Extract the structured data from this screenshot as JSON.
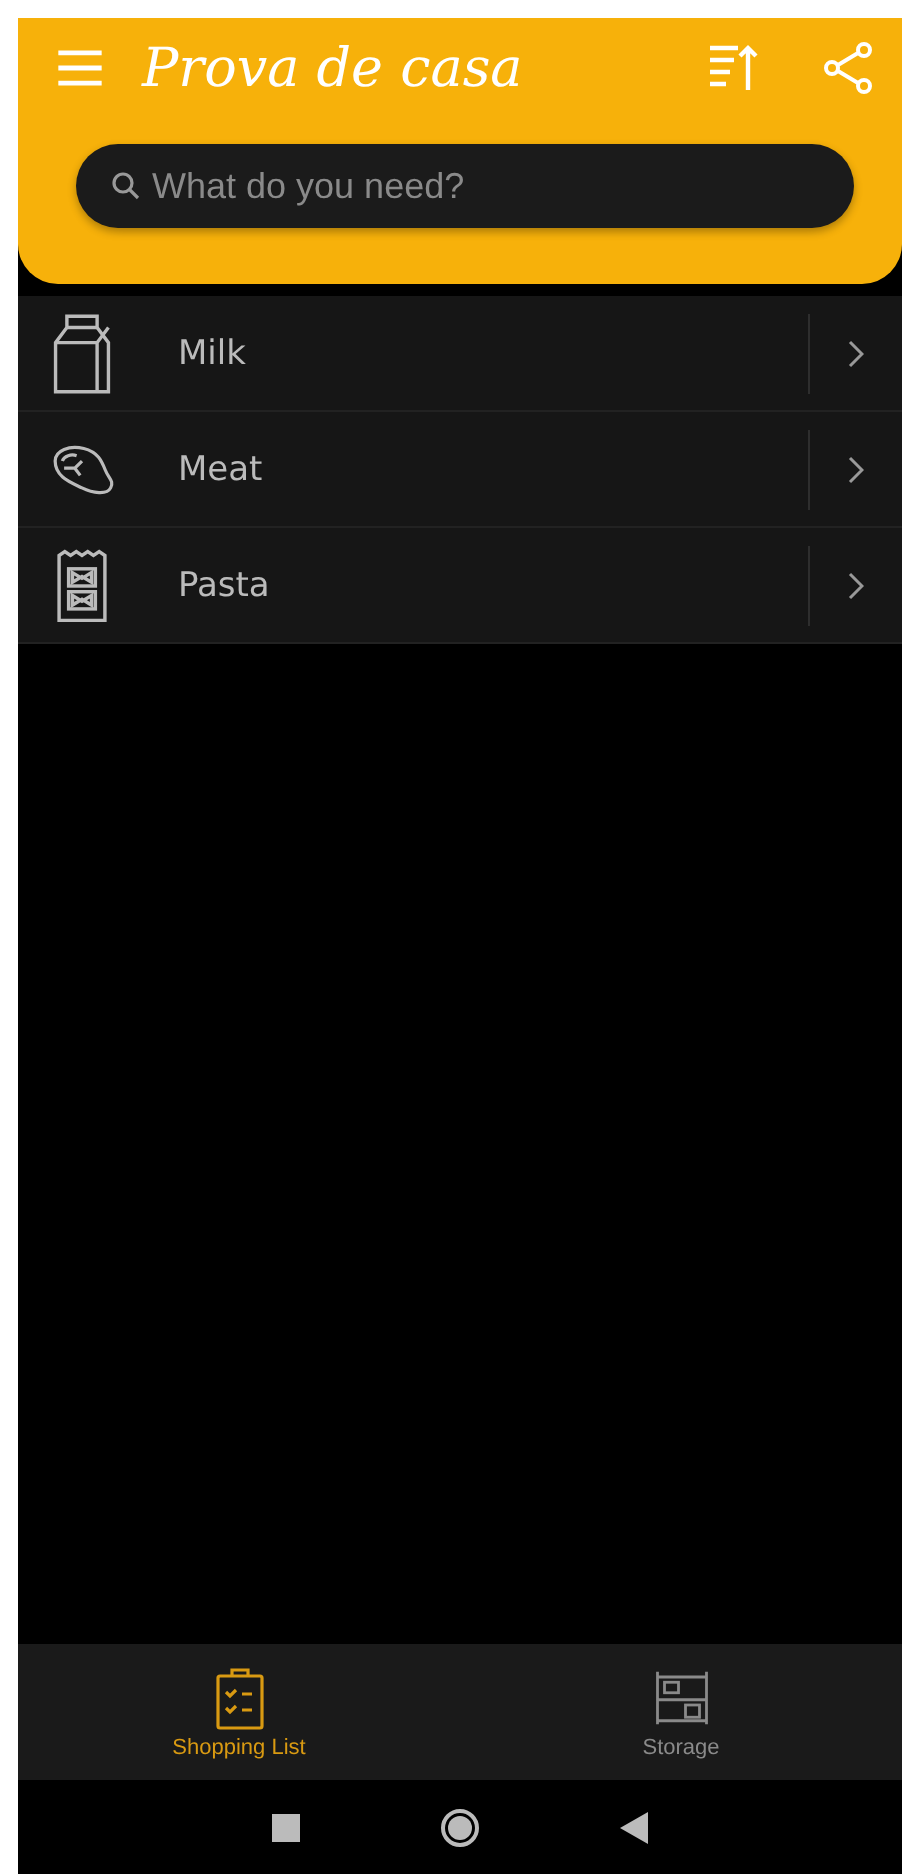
{
  "app_bar": {
    "title": "Prova de casa"
  },
  "search": {
    "placeholder": "What do you need?"
  },
  "items": [
    {
      "label": "Milk"
    },
    {
      "label": "Meat"
    },
    {
      "label": "Pasta"
    }
  ],
  "tabs": [
    {
      "label": "Shopping List",
      "selected": true
    },
    {
      "label": "Storage",
      "selected": false
    }
  ]
}
